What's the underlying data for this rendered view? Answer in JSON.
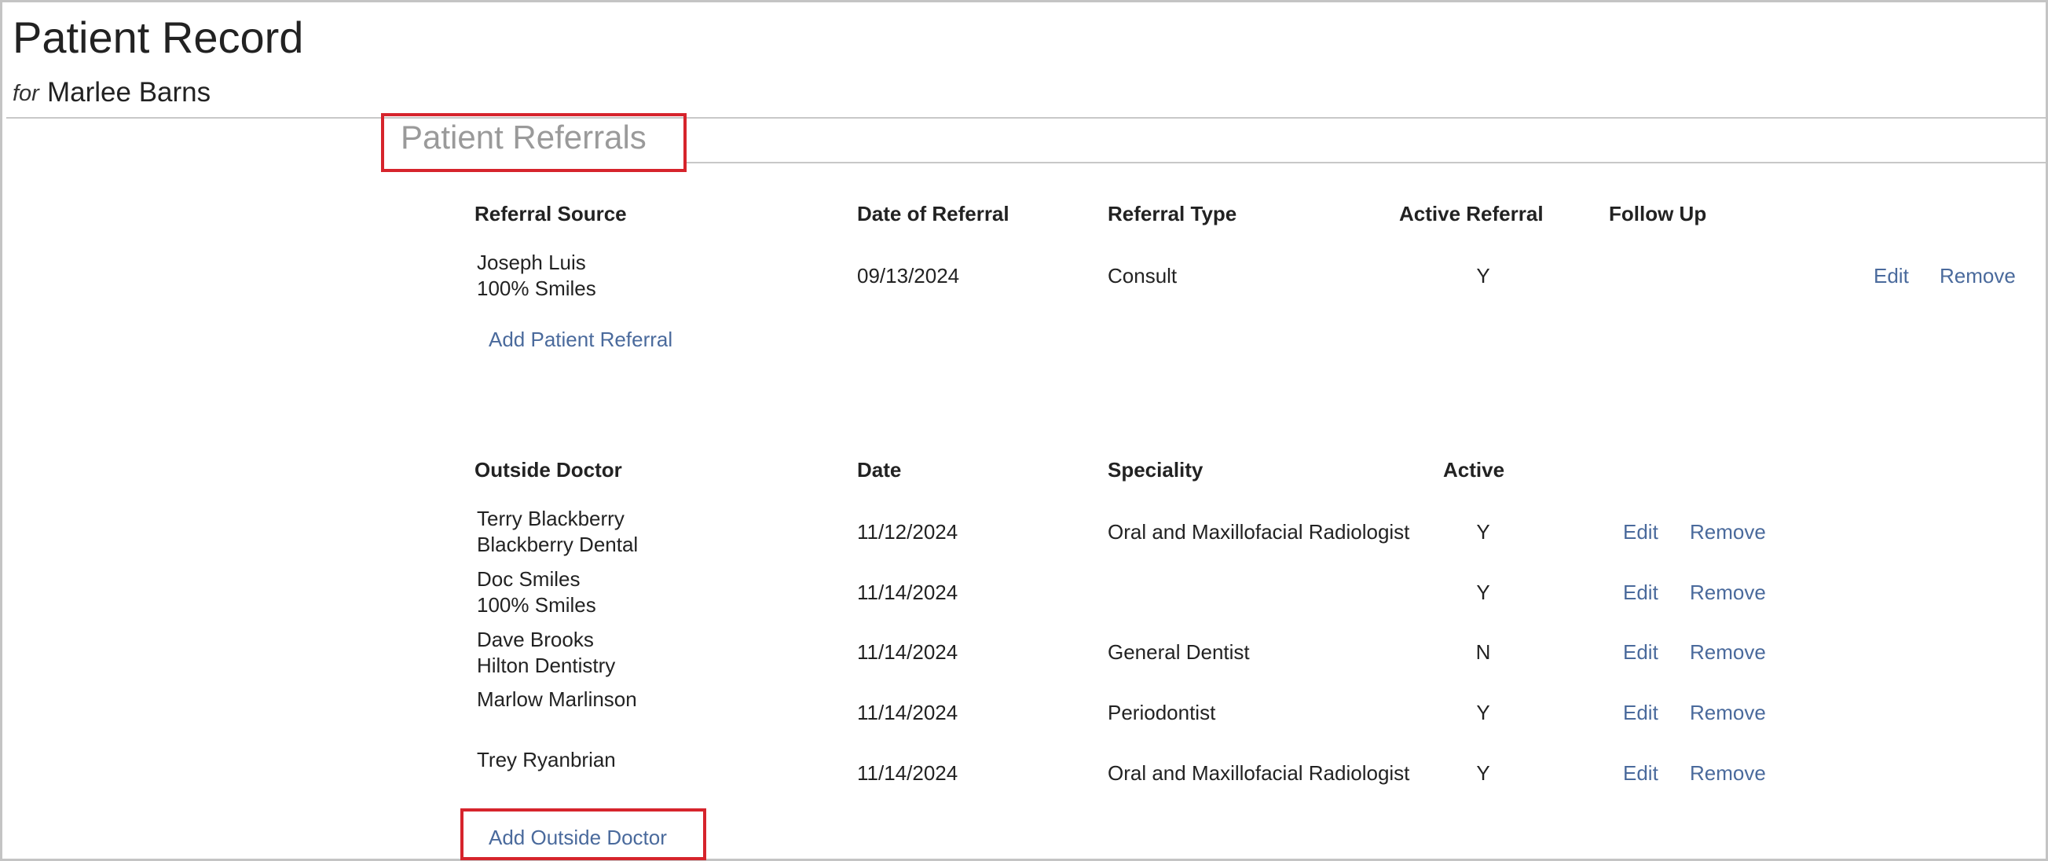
{
  "page": {
    "title": "Patient Record",
    "subtitle_prefix": "for",
    "patient_name": "Marlee Barns"
  },
  "referrals": {
    "section_title": "Patient Referrals",
    "headers": {
      "source": "Referral Source",
      "date": "Date of Referral",
      "type": "Referral Type",
      "active": "Active Referral",
      "follow_up": "Follow Up"
    },
    "rows": [
      {
        "source_name": "Joseph Luis",
        "source_practice": "100% Smiles",
        "date": "09/13/2024",
        "type": "Consult",
        "active": "Y",
        "follow_up": "",
        "edit": "Edit",
        "remove": "Remove"
      }
    ],
    "add_label": "Add Patient Referral"
  },
  "outside_doctors": {
    "headers": {
      "doctor": "Outside Doctor",
      "date": "Date",
      "speciality": "Speciality",
      "active": "Active"
    },
    "rows": [
      {
        "name": "Terry Blackberry",
        "practice": "Blackberry Dental",
        "date": "11/12/2024",
        "speciality": "Oral and Maxillofacial Radiologist",
        "active": "Y",
        "edit": "Edit",
        "remove": "Remove"
      },
      {
        "name": "Doc Smiles",
        "practice": "100% Smiles",
        "date": "11/14/2024",
        "speciality": "",
        "active": "Y",
        "edit": "Edit",
        "remove": "Remove"
      },
      {
        "name": "Dave Brooks",
        "practice": "Hilton Dentistry",
        "date": "11/14/2024",
        "speciality": "General Dentist",
        "active": "N",
        "edit": "Edit",
        "remove": "Remove"
      },
      {
        "name": "Marlow Marlinson",
        "practice": "",
        "date": "11/14/2024",
        "speciality": "Periodontist",
        "active": "Y",
        "edit": "Edit",
        "remove": "Remove"
      },
      {
        "name": "Trey Ryanbrian",
        "practice": "",
        "date": "11/14/2024",
        "speciality": "Oral and Maxillofacial Radiologist",
        "active": "Y",
        "edit": "Edit",
        "remove": "Remove"
      }
    ],
    "add_label": "Add Outside Doctor"
  },
  "colors": {
    "link": "#4a6a9c",
    "highlight": "#d6242c",
    "section_title": "#9a9a9a",
    "divider": "#c8c8c8"
  }
}
